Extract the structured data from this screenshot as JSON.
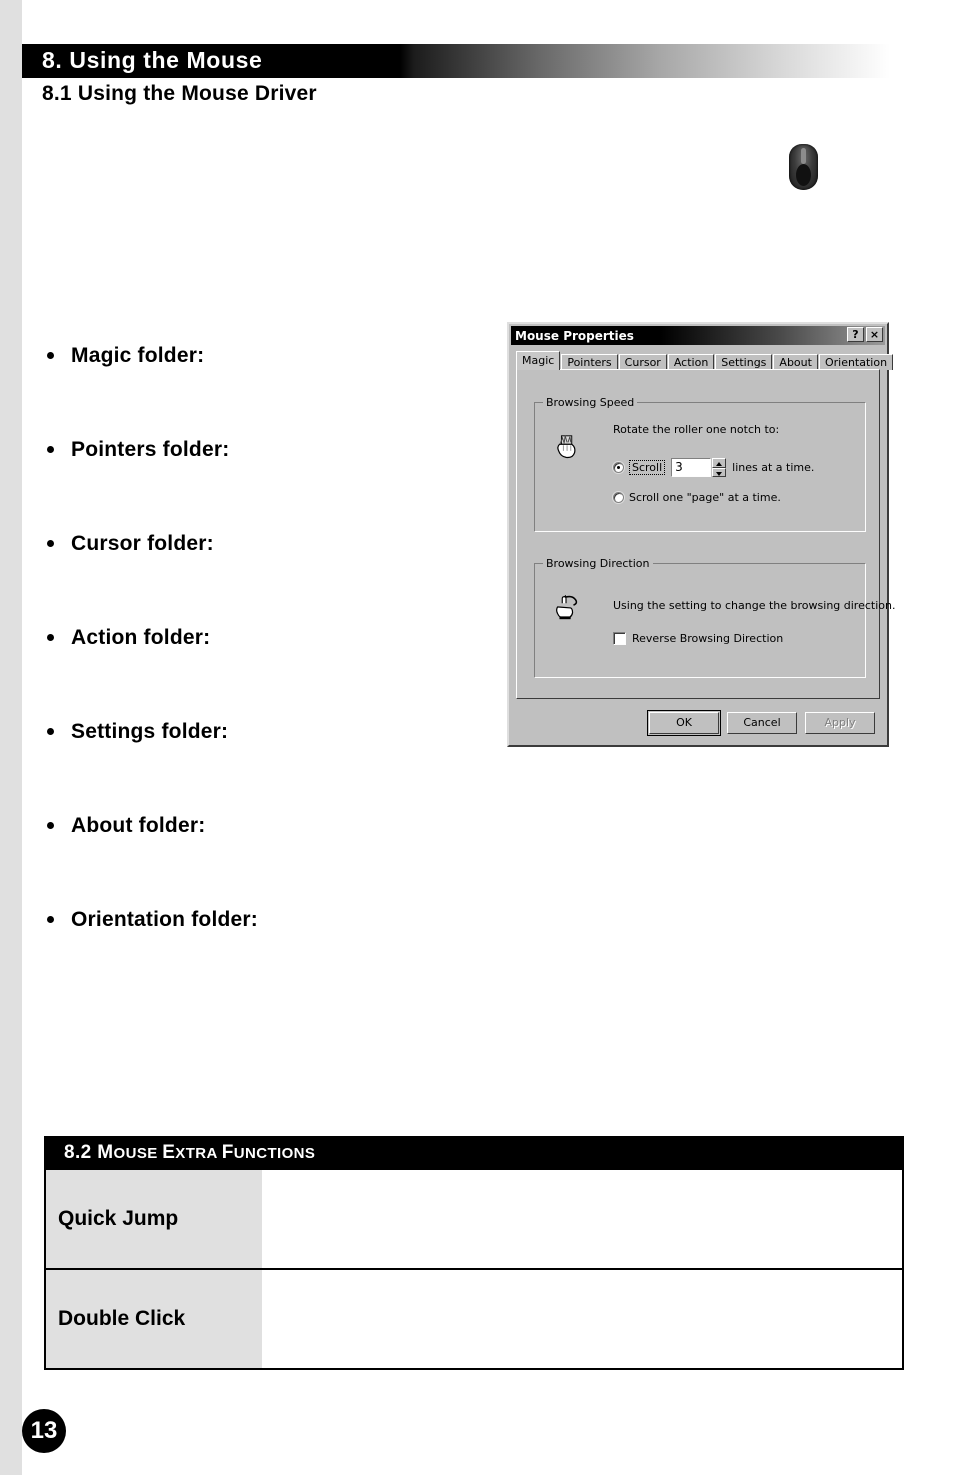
{
  "document": {
    "section_heading": "8. Using the Mouse",
    "subsection_heading": "8.1 Using the Mouse Driver",
    "page_number": "13"
  },
  "folder_list": [
    {
      "label": "Magic folder:"
    },
    {
      "label": "Pointers folder:"
    },
    {
      "label": "Cursor folder:"
    },
    {
      "label": "Action folder:"
    },
    {
      "label": "Settings folder:"
    },
    {
      "label": "About folder:"
    },
    {
      "label": "Orientation folder:"
    }
  ],
  "dialog": {
    "title": "Mouse Properties",
    "help_button": "?",
    "close_button": "×",
    "tabs": [
      {
        "label": "Magic",
        "active": true
      },
      {
        "label": "Pointers",
        "active": false
      },
      {
        "label": "Cursor",
        "active": false
      },
      {
        "label": "Action",
        "active": false
      },
      {
        "label": "Settings",
        "active": false
      },
      {
        "label": "About",
        "active": false
      },
      {
        "label": "Orientation",
        "active": false
      }
    ],
    "browsing_speed": {
      "group_title": "Browsing Speed",
      "instruction": "Rotate the roller one notch to:",
      "scroll_radio_label": "Scroll",
      "scroll_lines_value": "3",
      "scroll_lines_suffix": "lines at a time.",
      "page_radio_label": "Scroll one \"page\" at a time."
    },
    "browsing_direction": {
      "group_title": "Browsing Direction",
      "description": "Using the setting to change the browsing direction.",
      "reverse_checkbox_label": "Reverse Browsing Direction"
    },
    "buttons": {
      "ok": "OK",
      "cancel": "Cancel",
      "apply": "Apply"
    }
  },
  "extra_functions_table": {
    "header": "8.2 Mouse Extra Functions",
    "header_parts": {
      "num": "8.2 ",
      "w1_cap": "M",
      "w1_rest": "OUSE ",
      "w2_cap": "E",
      "w2_rest": "XTRA ",
      "w3_cap": "F",
      "w3_rest": "UNCTIONS"
    },
    "rows": [
      {
        "label": "Quick Jump",
        "value": ""
      },
      {
        "label": "Double Click",
        "value": ""
      }
    ]
  }
}
